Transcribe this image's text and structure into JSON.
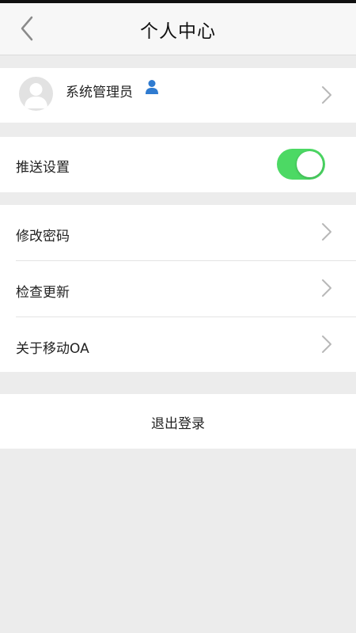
{
  "header": {
    "title": "个人中心",
    "back_icon": "chevron-left-icon"
  },
  "profile": {
    "name": "系统管理员",
    "avatar_icon": "default-avatar-icon",
    "user_icon": "user-icon",
    "user_icon_color": "#2f7bd0"
  },
  "push": {
    "label": "推送设置",
    "enabled": true,
    "toggle_color": "#4cd964"
  },
  "menu": {
    "items": [
      {
        "label": "修改密码"
      },
      {
        "label": "检查更新"
      },
      {
        "label": "关于移动OA"
      }
    ]
  },
  "logout": {
    "label": "退出登录"
  }
}
